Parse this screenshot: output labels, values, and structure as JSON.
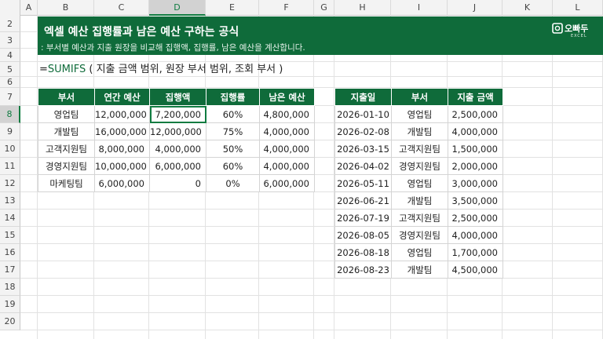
{
  "columns": [
    "A",
    "B",
    "C",
    "D",
    "E",
    "F",
    "G",
    "H",
    "I",
    "J",
    "K",
    "L"
  ],
  "selected_column": "D",
  "rows": [
    "2",
    "3",
    "4",
    "5",
    "6",
    "7",
    "8",
    "9",
    "10",
    "11",
    "12",
    "13",
    "14",
    "15",
    "16",
    "17",
    "18",
    "19",
    "20"
  ],
  "selected_row": "8",
  "banner": {
    "title": "엑셀 예산 집행률과 남은 예산 구하는 공식",
    "subtitle": ": 부서별 예산과 지출 원장을 비교해 집행액, 집행률, 남은 예산을 계산합니다.",
    "logo_text": "오빠두",
    "logo_sub": "EXCEL"
  },
  "formula": {
    "prefix": "=",
    "function": "SUMIFS",
    "args": " ( 지출 금액 범위, 원장 부서 범위, 조회 부서 )"
  },
  "budget_table": {
    "headers": [
      "부서",
      "연간 예산",
      "집행액",
      "집행률",
      "남은 예산"
    ],
    "rows": [
      [
        "영업팀",
        "12,000,000",
        "7,200,000",
        "60%",
        "4,800,000"
      ],
      [
        "개발팀",
        "16,000,000",
        "12,000,000",
        "75%",
        "4,000,000"
      ],
      [
        "고객지원팀",
        "8,000,000",
        "4,000,000",
        "50%",
        "4,000,000"
      ],
      [
        "경영지원팀",
        "10,000,000",
        "6,000,000",
        "60%",
        "4,000,000"
      ],
      [
        "마케팅팀",
        "6,000,000",
        "0",
        "0%",
        "6,000,000"
      ]
    ]
  },
  "ledger_table": {
    "headers": [
      "지출일",
      "부서",
      "지출 금액"
    ],
    "rows": [
      [
        "2026-01-10",
        "영업팀",
        "2,500,000"
      ],
      [
        "2026-02-08",
        "개발팀",
        "4,000,000"
      ],
      [
        "2026-03-15",
        "고객지원팀",
        "1,500,000"
      ],
      [
        "2026-04-02",
        "경영지원팀",
        "2,000,000"
      ],
      [
        "2026-05-11",
        "영업팀",
        "3,000,000"
      ],
      [
        "2026-06-21",
        "개발팀",
        "3,500,000"
      ],
      [
        "2026-07-19",
        "고객지원팀",
        "2,500,000"
      ],
      [
        "2026-08-05",
        "경영지원팀",
        "4,000,000"
      ],
      [
        "2026-08-18",
        "영업팀",
        "1,700,000"
      ],
      [
        "2026-08-23",
        "개발팀",
        "4,500,000"
      ]
    ]
  },
  "colors": {
    "brand_green": "#0f6b3a",
    "selection_green": "#107c41"
  }
}
